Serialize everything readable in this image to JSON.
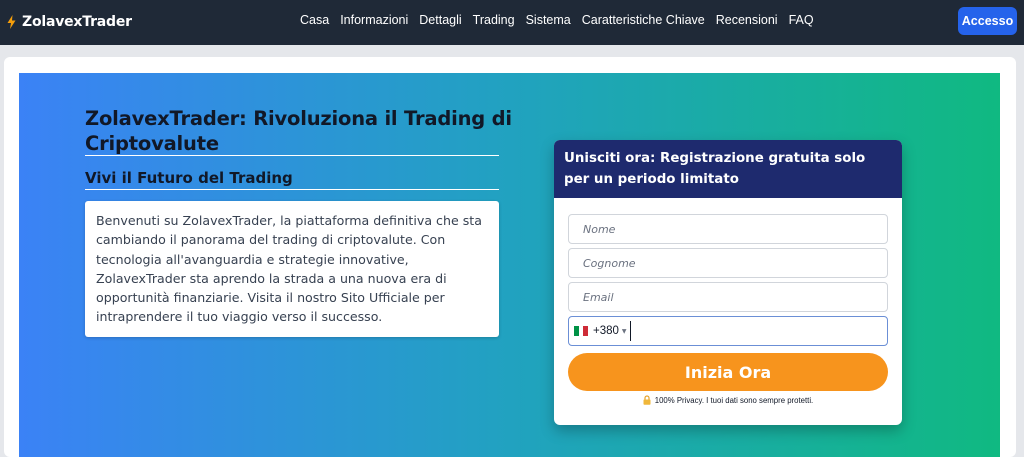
{
  "brand": {
    "name": "ZolavexTrader",
    "icon": "lightning-bolt-icon",
    "icon_color": "#f59e0b"
  },
  "nav": {
    "items": [
      "Casa",
      "Informazioni",
      "Dettagli",
      "Trading",
      "Sistema",
      "Caratteristiche Chiave",
      "Recensioni",
      "FAQ"
    ],
    "login_label": "Accesso"
  },
  "hero": {
    "title": "ZolavexTrader: Rivoluziona il Trading di Criptovalute",
    "subtitle": "Vivi il Futuro del Trading",
    "intro": "Benvenuti su ZolavexTrader, la piattaforma definitiva che sta cambiando il panorama del trading di criptovalute. Con tecnologia all'avanguardia e strategie innovative, ZolavexTrader sta aprendo la strada a una nuova era di opportunità finanziarie. Visita il nostro Sito Ufficiale per intraprendere il tuo viaggio verso il successo."
  },
  "form": {
    "heading": "Unisciti ora: Registrazione gratuita solo per un periodo limitato",
    "first_name_placeholder": "Nome",
    "last_name_placeholder": "Cognome",
    "email_placeholder": "Email",
    "phone_country": "Italy",
    "phone_dial_code": "+380",
    "phone_value": "",
    "submit_label": "Inizia Ora",
    "privacy_text": "100% Privacy. I tuoi dati sono sempre protetti."
  },
  "colors": {
    "navbar": "#1f2937",
    "login_button": "#2563eb",
    "gradient_start": "#3b82f6",
    "gradient_end": "#10b981",
    "form_header": "#1e2a6e",
    "cta": "#f7941d"
  }
}
